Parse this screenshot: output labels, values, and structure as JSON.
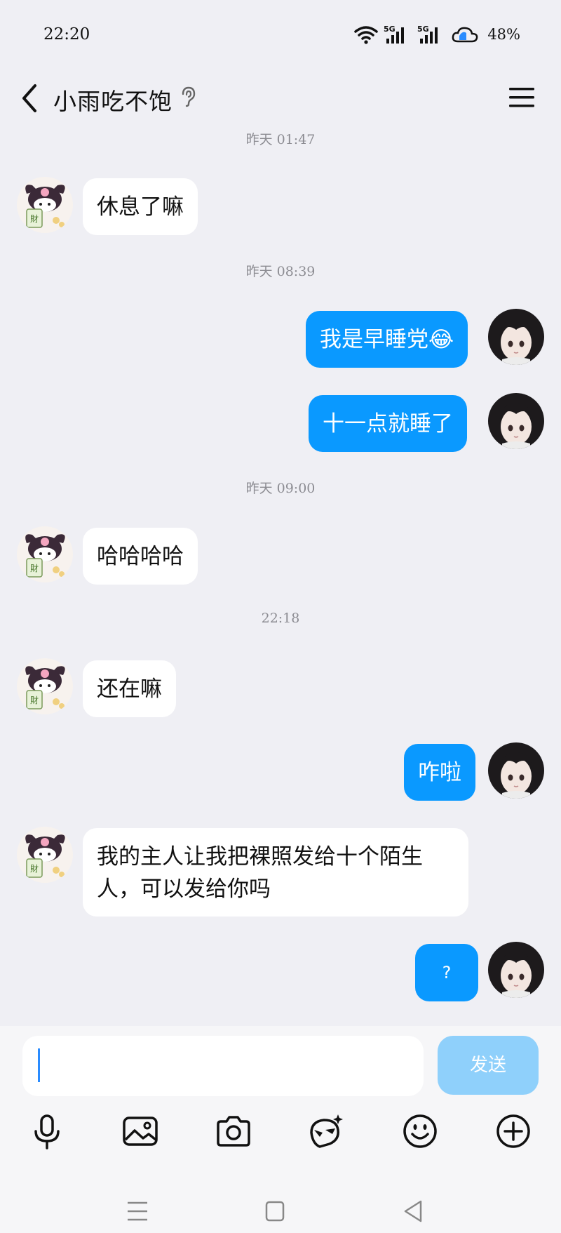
{
  "status_bar": {
    "time": "22:20",
    "battery": "48%",
    "icons": [
      "wifi-icon",
      "signal-5g-icon",
      "signal-5g-icon",
      "cloud-icon"
    ]
  },
  "nav": {
    "back_icon": "chevron-left-icon",
    "title": "小雨吃不饱",
    "ear_icon": "ear-icon",
    "menu_icon": "hamburger-menu-icon"
  },
  "timestamps": [
    "昨天 01:47",
    "昨天 08:39",
    "昨天 09:00",
    "22:18"
  ],
  "messages": [
    {
      "side": "in",
      "text": "休息了嘛"
    },
    {
      "side": "out",
      "text": "我是早睡党😂"
    },
    {
      "side": "out",
      "text": "十一点就睡了"
    },
    {
      "side": "in",
      "text": "哈哈哈哈"
    },
    {
      "side": "in",
      "text": "还在嘛"
    },
    {
      "side": "out",
      "text": "咋啦"
    },
    {
      "side": "in",
      "text": "我的主人让我把裸照发给十个陌生人，可以发给你吗"
    },
    {
      "side": "out",
      "text": "?"
    }
  ],
  "input": {
    "value": "",
    "send_label": "发送"
  },
  "toolbar": [
    "microphone-icon",
    "image-icon",
    "camera-icon",
    "sticker-icon",
    "emoji-icon",
    "plus-icon"
  ],
  "system_nav": [
    "recent-apps-icon",
    "home-icon",
    "back-icon"
  ],
  "colors": {
    "background": "#efeff4",
    "outgoing_bubble": "#0a99ff",
    "incoming_bubble": "#ffffff",
    "send_button": "#8fd0fb"
  }
}
